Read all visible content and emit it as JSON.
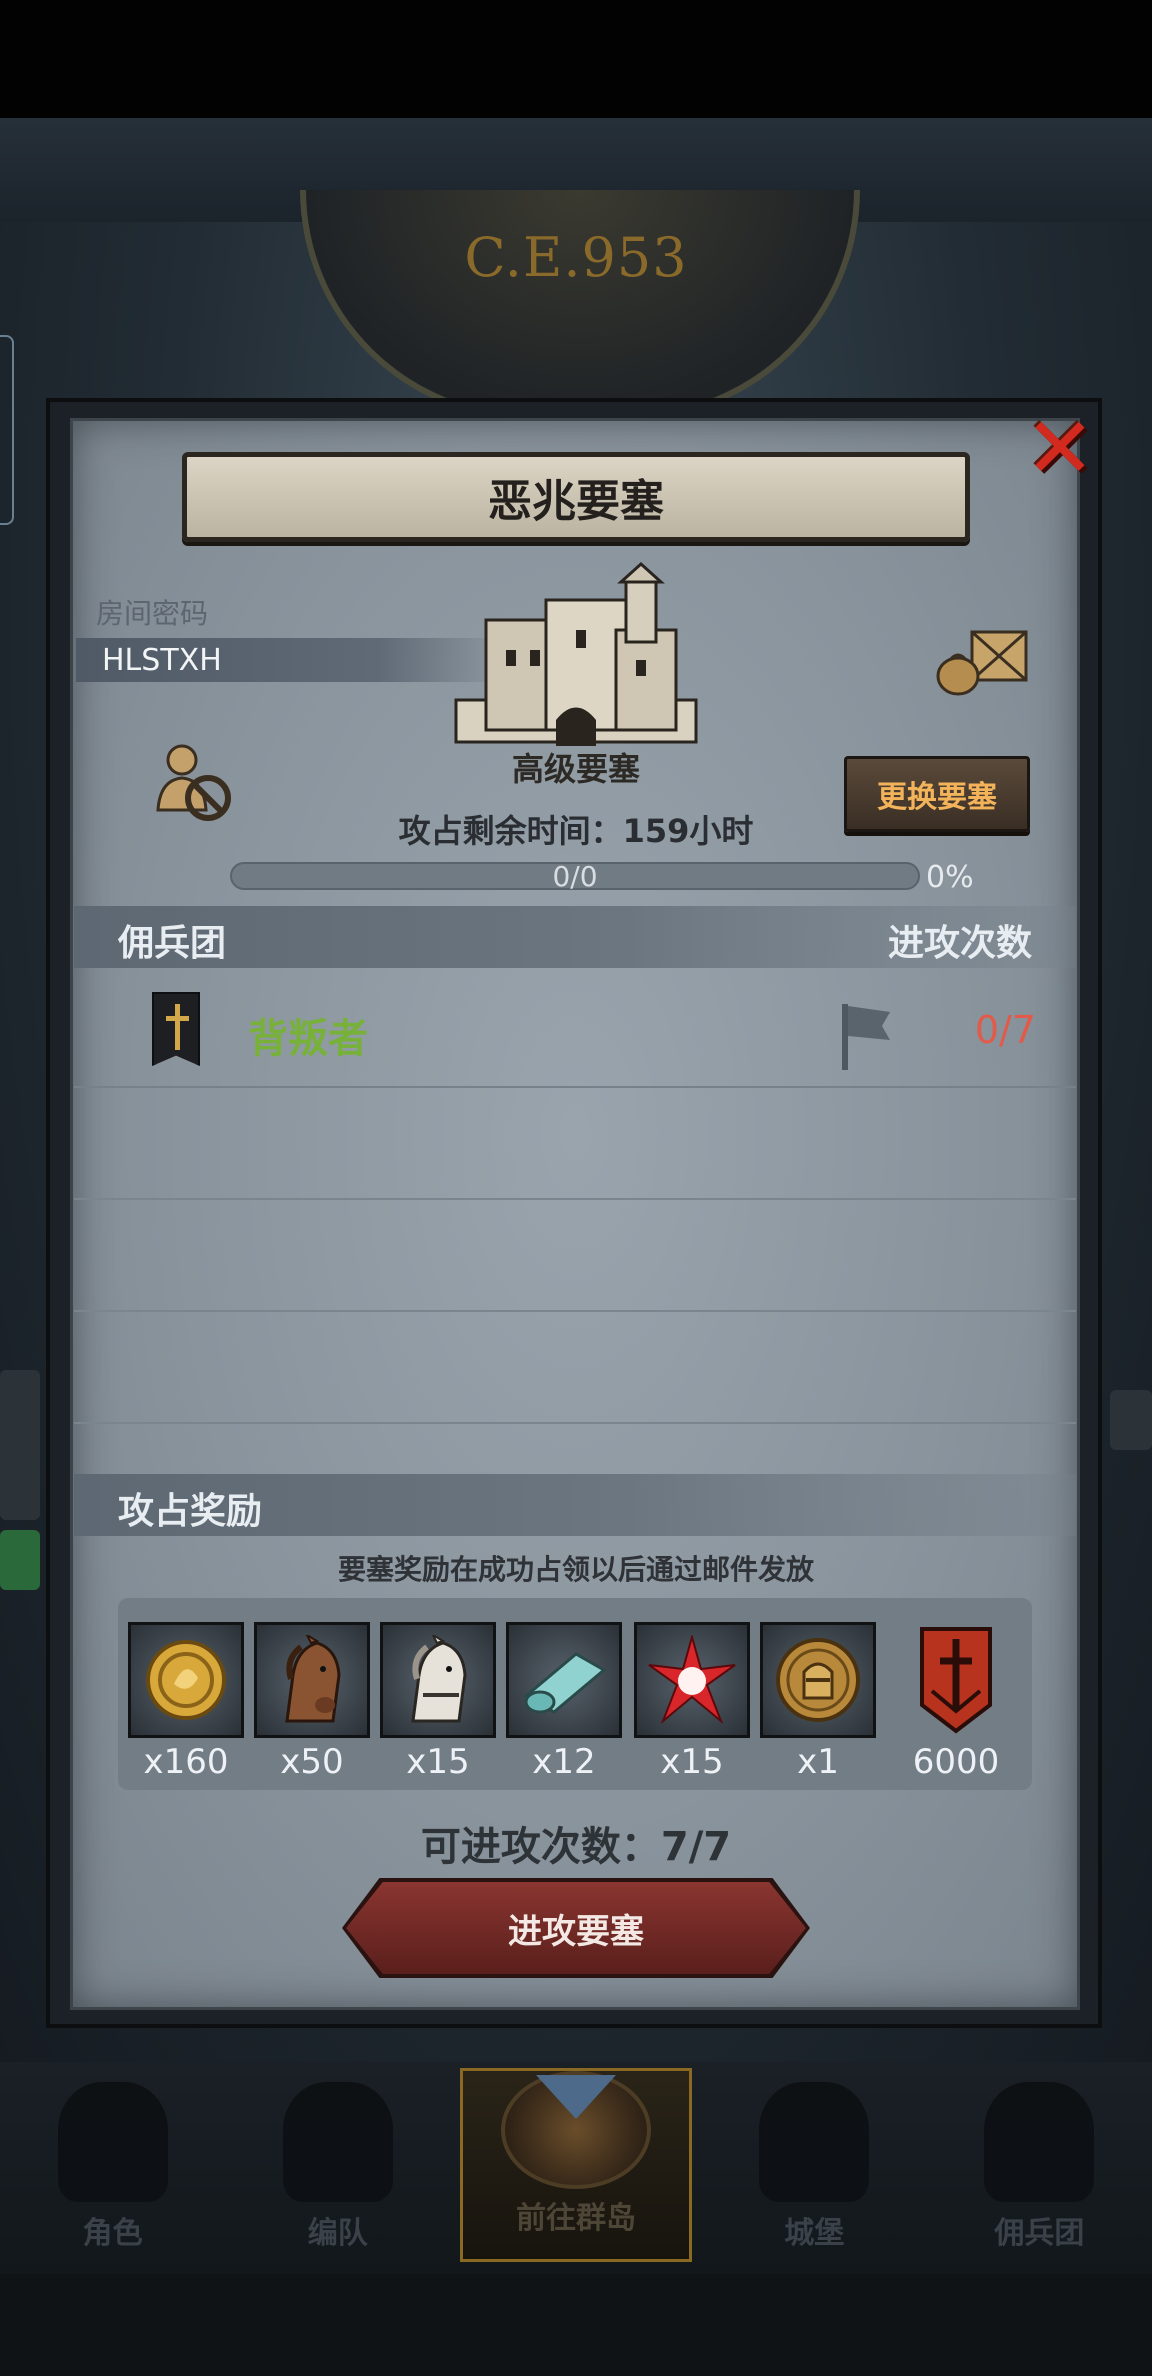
{
  "header": {
    "era": "C.E.953"
  },
  "modal": {
    "title": "恶兆要塞",
    "password_label": "房间密码",
    "password_value": "HLSTXH",
    "fortress_type": "高级要塞",
    "swap_button": "更换要塞",
    "time_left": "攻占剩余时间：159小时",
    "progress": {
      "text": "0/0",
      "percent": "0%",
      "fraction": 0
    },
    "mercenary_header": "佣兵团",
    "attack_count_header": "进攻次数",
    "mercenaries": [
      {
        "name": "背叛者",
        "attacks": "0/7"
      }
    ],
    "rewards_header": "攻占奖励",
    "rewards_note": "要塞奖励在成功占领以后通过邮件发放",
    "rewards": [
      {
        "icon": "gold-coin-icon",
        "qty": "x160"
      },
      {
        "icon": "brown-horse-icon",
        "qty": "x50"
      },
      {
        "icon": "white-horse-icon",
        "qty": "x15"
      },
      {
        "icon": "cloth-roll-icon",
        "qty": "x12"
      },
      {
        "icon": "red-star-icon",
        "qty": "x15"
      },
      {
        "icon": "knight-medal-icon",
        "qty": "x1"
      },
      {
        "icon": "red-banner-icon",
        "qty": "6000"
      }
    ],
    "attacks_left": "可进攻次数：7/7",
    "attack_button": "进攻要塞"
  },
  "nav": {
    "tabs": [
      {
        "label": "角色"
      },
      {
        "label": "编队"
      },
      {
        "label": "前往群岛"
      },
      {
        "label": "城堡"
      },
      {
        "label": "佣兵团"
      }
    ],
    "active_index": 2
  },
  "colors": {
    "accent_green": "#78b13a",
    "count_red": "#e25a4a",
    "button_gold": "#f2b35a",
    "close_red": "#d32a20"
  }
}
